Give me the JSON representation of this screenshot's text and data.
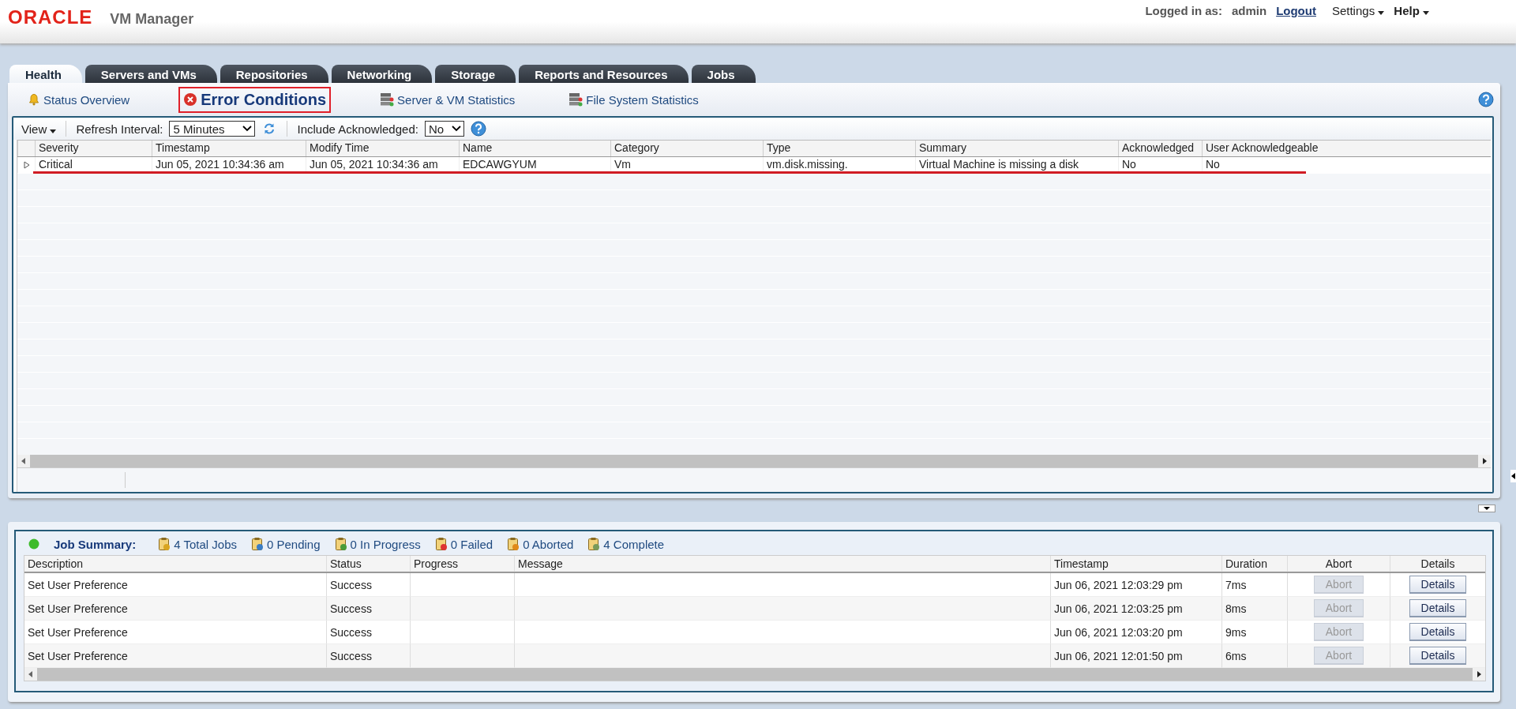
{
  "header": {
    "brand": "ORACLE",
    "product": "VM Manager",
    "logged_in_label": "Logged in as:",
    "user": "admin",
    "logout": "Logout",
    "menus": [
      "Settings",
      "Help"
    ]
  },
  "tabs": [
    {
      "label": "Health",
      "selected": true
    },
    {
      "label": "Servers and VMs",
      "selected": false
    },
    {
      "label": "Repositories",
      "selected": false
    },
    {
      "label": "Networking",
      "selected": false
    },
    {
      "label": "Storage",
      "selected": false
    },
    {
      "label": "Reports and Resources",
      "selected": false
    },
    {
      "label": "Jobs",
      "selected": false
    }
  ],
  "subtabs": [
    {
      "label": "Status Overview",
      "kind": "bell",
      "selected": false
    },
    {
      "label": "Error Conditions",
      "kind": "error",
      "selected": true
    },
    {
      "label": "Server & VM Statistics",
      "kind": "servers",
      "selected": false
    },
    {
      "label": "File System Statistics",
      "kind": "servers",
      "selected": false
    }
  ],
  "toolbar": {
    "view": "View",
    "refresh_label": "Refresh Interval:",
    "refresh_value": "5 Minutes",
    "ack_label": "Include Acknowledged:",
    "ack_value": "No"
  },
  "errors": {
    "columns": [
      "Severity",
      "Timestamp",
      "Modify Time",
      "Name",
      "Category",
      "Type",
      "Summary",
      "Acknowledged",
      "User Acknowledgeable"
    ],
    "rows": [
      {
        "cells": [
          "Critical",
          "Jun 05, 2021 10:34:36 am",
          "Jun 05, 2021 10:34:36 am",
          "EDCAWGYUM",
          "Vm",
          "vm.disk.missing.",
          "Virtual Machine is missing a disk",
          "No",
          "No"
        ],
        "expanded": false,
        "underlined": true
      }
    ]
  },
  "job_summary": {
    "title": "Job Summary:",
    "counts": [
      {
        "label": "4 Total Jobs",
        "kind": "total"
      },
      {
        "label": "0 Pending",
        "kind": "pending"
      },
      {
        "label": "0 In Progress",
        "kind": "progress"
      },
      {
        "label": "0 Failed",
        "kind": "failed"
      },
      {
        "label": "0 Aborted",
        "kind": "aborted"
      },
      {
        "label": "4 Complete",
        "kind": "complete"
      }
    ],
    "columns": [
      "Description",
      "Status",
      "Progress",
      "Message",
      "Timestamp",
      "Duration",
      "Abort",
      "Details"
    ],
    "rows": [
      {
        "description": "Set User Preference",
        "status": "Success",
        "timestamp": "Jun 06, 2021 12:03:29 pm",
        "duration": "7ms",
        "abort": "Abort",
        "abort_disabled": true,
        "details": "Details"
      },
      {
        "description": "Set User Preference",
        "status": "Success",
        "timestamp": "Jun 06, 2021 12:03:25 pm",
        "duration": "8ms",
        "abort": "Abort",
        "abort_disabled": true,
        "details": "Details"
      },
      {
        "description": "Set User Preference",
        "status": "Success",
        "timestamp": "Jun 06, 2021 12:03:20 pm",
        "duration": "9ms",
        "abort": "Abort",
        "abort_disabled": true,
        "details": "Details"
      },
      {
        "description": "Set User Preference",
        "status": "Success",
        "timestamp": "Jun 06, 2021 12:01:50 pm",
        "duration": "6ms",
        "abort": "Abort",
        "abort_disabled": true,
        "details": "Details"
      }
    ]
  }
}
